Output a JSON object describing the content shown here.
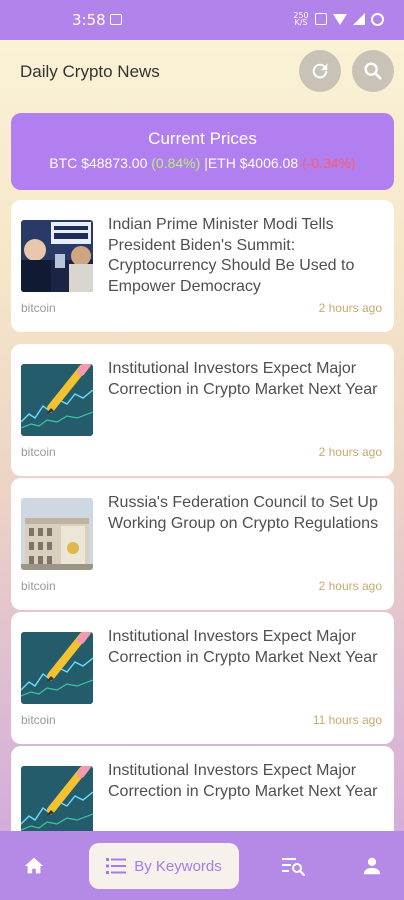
{
  "status_bar": {
    "time": "3:58",
    "data_label": "250 K/S"
  },
  "header": {
    "title": "Daily Crypto News",
    "refresh_icon": "refresh-icon",
    "search_icon": "search-icon"
  },
  "prices": {
    "title": "Current Prices",
    "btc_label": "BTC",
    "btc_price": "$48873.00",
    "btc_change": "(0.84%)",
    "separator": "|",
    "eth_label": "ETH",
    "eth_price": "$4006.08",
    "eth_change": "(-0.34%)",
    "colors": {
      "positive": "#b9f07a",
      "negative": "#ff5b6b",
      "panel": "#b17ff0"
    }
  },
  "articles": [
    {
      "title": "Indian Prime Minister Modi Tells President Biden's Summit: Cryptocurrency Should Be Used to Empower Democracy",
      "tag": "bitcoin",
      "time": "2 hours ago",
      "thumb": "summit-photo"
    },
    {
      "title": "Institutional Investors Expect Major Correction in Crypto Market Next Year",
      "tag": "bitcoin",
      "time": "2 hours ago",
      "thumb": "chart-pencil"
    },
    {
      "title": "Russia's Federation Council to Set Up Working Group on Crypto Regulations",
      "tag": "bitcoin",
      "time": "2 hours ago",
      "thumb": "building"
    },
    {
      "title": "Institutional Investors Expect Major Correction in Crypto Market Next Year",
      "tag": "bitcoin",
      "time": "11 hours ago",
      "thumb": "chart-pencil"
    },
    {
      "title": "Institutional Investors Expect Major Correction in Crypto Market Next Year",
      "tag": "",
      "time": "",
      "thumb": "chart-pencil"
    }
  ],
  "nav": {
    "home_icon": "home-icon",
    "keywords_label": "By Keywords",
    "keywords_icon": "list-icon",
    "search_list_icon": "list-search-icon",
    "profile_icon": "person-icon",
    "accent": "#b58ae6"
  }
}
